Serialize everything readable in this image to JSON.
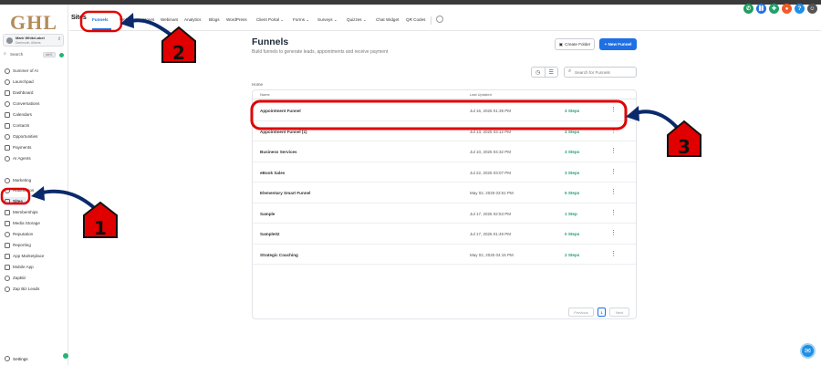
{
  "logo": "GHL",
  "account": {
    "name": "Mark WhiteLabel",
    "sub": "Dartmouth, Alberta"
  },
  "sidebar": {
    "search_label": "Search",
    "search_shortcut": "ctrl K",
    "items": [
      {
        "label": "Summer of AI",
        "icon": "sparkles-icon"
      },
      {
        "label": "Launchpad",
        "icon": "rocket-icon"
      },
      {
        "label": "Dashboard",
        "icon": "dashboard-icon"
      },
      {
        "label": "Conversations",
        "icon": "chat-icon"
      },
      {
        "label": "Calendars",
        "icon": "calendar-icon"
      },
      {
        "label": "Contacts",
        "icon": "contacts-icon"
      },
      {
        "label": "Opportunities",
        "icon": "opportunities-icon"
      },
      {
        "label": "Payments",
        "icon": "payments-icon"
      },
      {
        "label": "AI Agents",
        "icon": "ai-agents-icon"
      },
      {
        "label": "Marketing",
        "icon": "marketing-icon"
      },
      {
        "label": "Automation",
        "icon": "automation-icon"
      },
      {
        "label": "Sites",
        "icon": "sites-icon"
      },
      {
        "label": "Memberships",
        "icon": "memberships-icon"
      },
      {
        "label": "Media Storage",
        "icon": "media-icon"
      },
      {
        "label": "Reputation",
        "icon": "star-icon"
      },
      {
        "label": "Reporting",
        "icon": "reporting-icon"
      },
      {
        "label": "App Marketplace",
        "icon": "marketplace-icon"
      },
      {
        "label": "Mobile App",
        "icon": "mobile-icon"
      },
      {
        "label": "ZapBiz",
        "icon": "zapbiz-icon"
      },
      {
        "label": "Zap Biz Leads",
        "icon": "zapbiz-leads-icon"
      }
    ],
    "settings_label": "Settings"
  },
  "tabs": {
    "section_title": "Sites",
    "items": [
      {
        "label": "Funnels",
        "active": true
      },
      {
        "label": "Websites"
      },
      {
        "label": "Stores"
      },
      {
        "label": "Webinars"
      },
      {
        "label": "Analytics"
      },
      {
        "label": "Blogs"
      },
      {
        "label": "WordPress"
      },
      {
        "label": "Client Portal ⌄"
      },
      {
        "label": "Forms ⌄"
      },
      {
        "label": "Surveys ⌄"
      },
      {
        "label": "Quizzes ⌄"
      },
      {
        "label": "Chat Widget"
      },
      {
        "label": "QR Codes"
      }
    ]
  },
  "header_icons": [
    {
      "name": "phone-icon",
      "color": "#1e9e5a",
      "glyph": "✆"
    },
    {
      "name": "link-icon",
      "color": "#1f6fe5",
      "glyph": "⛓"
    },
    {
      "name": "megaphone-icon",
      "color": "#22a06b",
      "glyph": "✚"
    },
    {
      "name": "bell-icon",
      "color": "#f05a28",
      "glyph": "●"
    },
    {
      "name": "help-icon",
      "color": "#1f8fe5",
      "glyph": "?"
    },
    {
      "name": "profile-avatar-icon",
      "color": "#555555",
      "glyph": "☺"
    }
  ],
  "page": {
    "title": "Funnels",
    "subtitle": "Build funnels to generate leads, appointments and receive payment",
    "create_folder_label": "Create Folder",
    "new_funnel_label": "+ New Funnel",
    "search_placeholder": "Search for Funnels",
    "breadcrumb": "Home"
  },
  "table": {
    "headers": {
      "name": "Name",
      "updated": "Last Updated"
    },
    "rows": [
      {
        "name": "Appointment Funnel",
        "updated": "Jul 16, 2025 01:39 PM",
        "steps": "3 Steps"
      },
      {
        "name": "Appointment Funnel (1)",
        "updated": "Jul 13, 2025 03:12 PM",
        "steps": "3 Steps"
      },
      {
        "name": "Business Services",
        "updated": "Jul 10, 2025 04:32 PM",
        "steps": "3 Steps"
      },
      {
        "name": "eBook Sales",
        "updated": "Jul 22, 2025 03:07 PM",
        "steps": "3 Steps"
      },
      {
        "name": "Elementary Smart Funnel",
        "updated": "May 02, 2025 03:51 PM",
        "steps": "5 Steps"
      },
      {
        "name": "Sample",
        "updated": "Jul 17, 2025 02:53 PM",
        "steps": "1 Step"
      },
      {
        "name": "Sample02",
        "updated": "Jul 17, 2025 01:49 PM",
        "steps": "0 Steps"
      },
      {
        "name": "Strategic Coaching",
        "updated": "May 02, 2025 04:15 PM",
        "steps": "2 Steps"
      }
    ]
  },
  "pagination": {
    "previous": "Previous",
    "page": "1",
    "next": "Next"
  },
  "annotations": {
    "one": "1",
    "two": "2",
    "three": "3",
    "highlight_color": "#e00000",
    "arrow_color": "#0b2a6b"
  }
}
